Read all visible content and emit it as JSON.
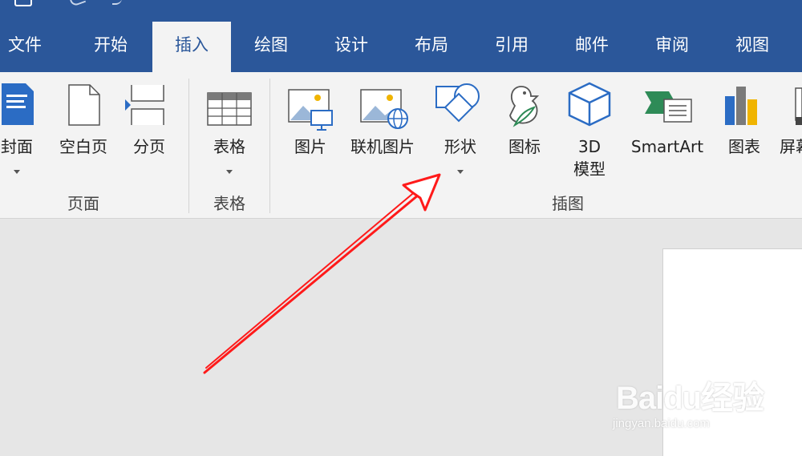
{
  "tabs": [
    {
      "label": "文件",
      "active": false
    },
    {
      "label": "开始",
      "active": false
    },
    {
      "label": "插入",
      "active": true
    },
    {
      "label": "绘图",
      "active": false
    },
    {
      "label": "设计",
      "active": false
    },
    {
      "label": "布局",
      "active": false
    },
    {
      "label": "引用",
      "active": false
    },
    {
      "label": "邮件",
      "active": false
    },
    {
      "label": "审阅",
      "active": false
    },
    {
      "label": "视图",
      "active": false
    }
  ],
  "ribbon": {
    "pages_group": {
      "label": "页面",
      "buttons": [
        {
          "label": "封面",
          "icon": "cover-page-icon",
          "has_dropdown": true
        },
        {
          "label": "空白页",
          "icon": "blank-page-icon",
          "has_dropdown": false
        },
        {
          "label": "分页",
          "icon": "page-break-icon",
          "has_dropdown": false
        }
      ]
    },
    "table_group": {
      "label": "表格",
      "buttons": [
        {
          "label": "表格",
          "icon": "table-icon",
          "has_dropdown": true
        }
      ]
    },
    "illustrations_group": {
      "label": "插图",
      "buttons": [
        {
          "label": "图片",
          "icon": "picture-icon",
          "has_dropdown": false
        },
        {
          "label": "联机图片",
          "icon": "online-picture-icon",
          "has_dropdown": false
        },
        {
          "label": "形状",
          "icon": "shapes-icon",
          "has_dropdown": true
        },
        {
          "label": "图标",
          "icon": "icons-icon",
          "has_dropdown": false
        },
        {
          "label": "3D",
          "label2": "模型",
          "icon": "3d-model-icon",
          "has_dropdown": false
        },
        {
          "label": "SmartArt",
          "icon": "smartart-icon",
          "has_dropdown": false
        },
        {
          "label": "图表",
          "icon": "chart-icon",
          "has_dropdown": false
        },
        {
          "label": "屏幕",
          "icon": "screenshot-icon",
          "has_dropdown": false
        }
      ]
    }
  },
  "watermark": {
    "brand": "Baidu经验",
    "url": "jingyan.baidu.com"
  },
  "colors": {
    "accent": "#2b579a",
    "ribbon_bg": "#f3f3f3",
    "workspace_bg": "#e6e6e6",
    "annotation": "#ff0000"
  }
}
